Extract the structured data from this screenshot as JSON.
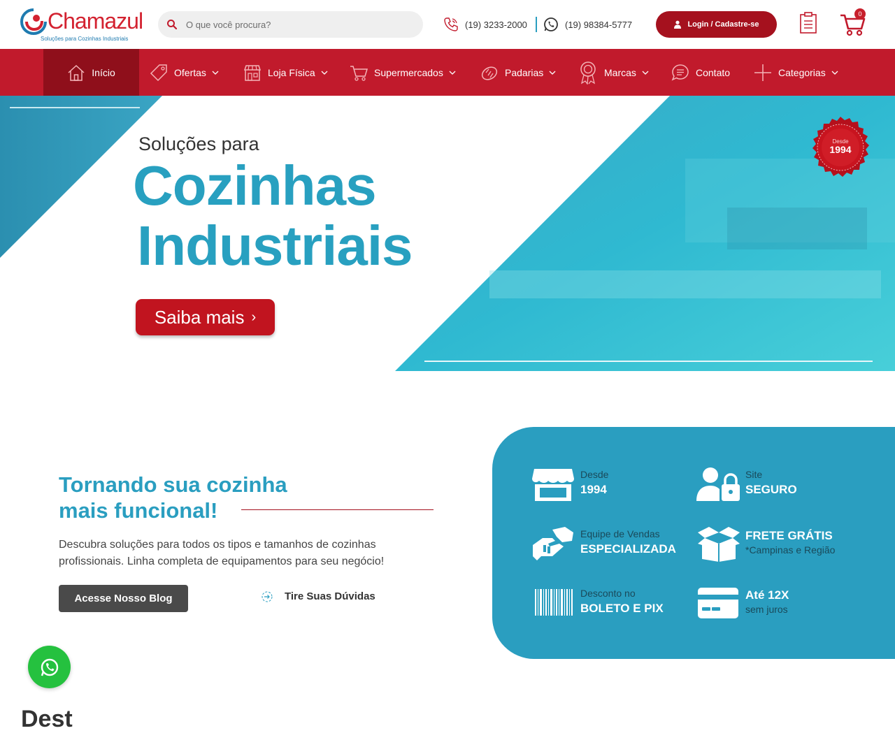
{
  "header": {
    "logo_name": "Chamazul",
    "logo_tagline": "Soluções para Cozinhas Industriais",
    "search_placeholder": "O que você procura?",
    "phone": "(19) 3233-2000",
    "whatsapp": "(19) 98384-5777",
    "login_label": "Login / Cadastre-se",
    "cart_count": "0"
  },
  "nav": {
    "items": [
      {
        "label": "Início",
        "icon": "home-icon",
        "active": true,
        "dropdown": false
      },
      {
        "label": "Ofertas",
        "icon": "tag-icon",
        "dropdown": true
      },
      {
        "label": "Loja Física",
        "icon": "store-icon",
        "dropdown": true
      },
      {
        "label": "Supermercados",
        "icon": "cart-icon",
        "dropdown": true
      },
      {
        "label": "Padarias",
        "icon": "bread-icon",
        "dropdown": true
      },
      {
        "label": "Marcas",
        "icon": "award-icon",
        "dropdown": true
      },
      {
        "label": "Contato",
        "icon": "chat-icon",
        "dropdown": false
      },
      {
        "label": "Categorias",
        "icon": "plus-icon",
        "dropdown": true
      }
    ]
  },
  "hero": {
    "subtitle": "Soluções para",
    "title_line1": "Cozinhas",
    "title_line2": "Industriais",
    "cta_label": "Saiba mais",
    "seal_top": "Desde",
    "seal_year": "1994"
  },
  "intro": {
    "title_line1": "Tornando sua cozinha",
    "title_line2": "mais funcional!",
    "text": "Descubra soluções para todos os tipos e tamanhos de cozinhas profissionais. Linha completa de equipamentos para seu negócio!",
    "blog_button": "Acesse Nosso Blog",
    "faq_link": "Tire Suas Dúvidas"
  },
  "features": [
    {
      "line1": "Desde",
      "line2": "1994",
      "icon": "storefront-icon"
    },
    {
      "line1": "Site",
      "line2": "SEGURO",
      "icon": "secure-user-icon"
    },
    {
      "line1": "Equipe de Vendas",
      "line2": "ESPECIALIZADA",
      "icon": "handshake-icon"
    },
    {
      "line1": "FRETE GRÁTIS",
      "line2": "*Campinas e Região",
      "icon": "open-box-icon"
    },
    {
      "line1": "Desconto no",
      "line2": "BOLETO E PIX",
      "icon": "barcode-icon"
    },
    {
      "line1": "Até 12X",
      "line2": "sem juros",
      "icon": "credit-card-icon"
    }
  ],
  "next_section": {
    "heading": "Dest"
  },
  "colors": {
    "brand_red": "#c11a2c",
    "dark_red": "#a5111e",
    "brand_blue": "#2a9ec0",
    "whatsapp_green": "#25c13f"
  }
}
